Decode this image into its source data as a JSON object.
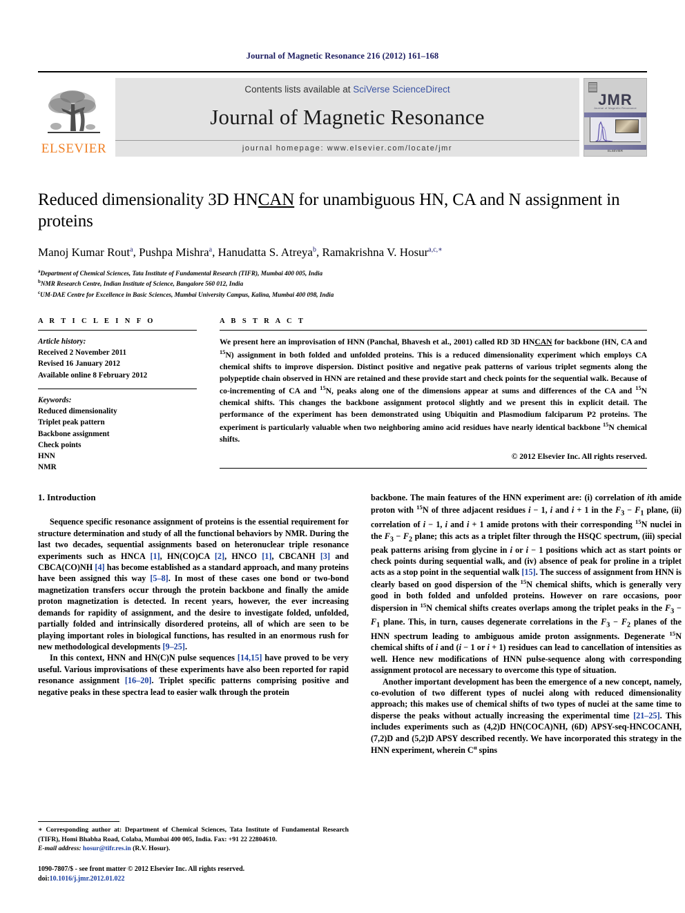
{
  "running_head": "Journal of Magnetic Resonance 216 (2012) 161–168",
  "masthead": {
    "publisher_logo_text": "ELSEVIER",
    "contents_prefix": "Contents lists available at ",
    "contents_link": "SciVerse ScienceDirect",
    "journal_name": "Journal of Magnetic Resonance",
    "homepage": "journal homepage: www.elsevier.com/locate/jmr",
    "cover": {
      "title": "JMR",
      "subtitle": "Journal of Magnetic Resonance",
      "publisher": "ELSEVIER"
    }
  },
  "article": {
    "title_part1": "Reduced dimensionality 3D HN",
    "title_underlined": "CAN",
    "title_part2": " for unambiguous HN, CA and N assignment in proteins",
    "authors": [
      {
        "name": "Manoj Kumar Rout",
        "sup": "a"
      },
      {
        "name": "Pushpa Mishra",
        "sup": "a"
      },
      {
        "name": "Hanudatta S. Atreya",
        "sup": "b"
      },
      {
        "name": "Ramakrishna V. Hosur",
        "sup": "a,c,∗"
      }
    ],
    "affiliations": [
      {
        "mark": "a",
        "text": "Department of Chemical Sciences, Tata Institute of Fundamental Research (TIFR), Mumbai 400 005, India"
      },
      {
        "mark": "b",
        "text": "NMR Research Centre, Indian Institute of Science, Bangalore 560 012, India"
      },
      {
        "mark": "c",
        "text": "UM-DAE Centre for Excellence in Basic Sciences, Mumbai University Campus, Kalina, Mumbai 400 098, India"
      }
    ]
  },
  "article_info": {
    "heading": "A R T I C L E   I N F O",
    "history_label": "Article history:",
    "history": [
      "Received 2 November 2011",
      "Revised 16 January 2012",
      "Available online 8 February 2012"
    ],
    "keywords_label": "Keywords:",
    "keywords": [
      "Reduced dimensionality",
      "Triplet peak pattern",
      "Backbone assignment",
      "Check points",
      "HNN",
      "NMR"
    ]
  },
  "abstract": {
    "heading": "A B S T R A C T",
    "text_1": "We present here an improvisation of HNN (Panchal, Bhavesh et al., 2001) called RD 3D HN",
    "text_underlined": "CAN",
    "text_2": " for backbone (HN, CA and ",
    "sup_1": "15",
    "text_3": "N) assignment in both folded and unfolded proteins. This is a reduced dimensionality experiment which employs CA chemical shifts to improve dispersion. Distinct positive and negative peak patterns of various triplet segments along the polypeptide chain observed in HNN are retained and these provide start and check points for the sequential walk. Because of co-incrementing of CA and ",
    "sup_2": "15",
    "text_4": "N, peaks along one of the dimensions appear at sums and differences of the CA and ",
    "sup_3": "15",
    "text_5": "N chemical shifts. This changes the backbone assignment protocol slightly and we present this in explicit detail. The performance of the experiment has been demonstrated using Ubiquitin and Plasmodium falciparum P2 proteins. The experiment is particularly valuable when two neighboring amino acid residues have nearly identical backbone ",
    "sup_4": "15",
    "text_6": "N chemical shifts.",
    "copyright": "© 2012 Elsevier Inc. All rights reserved."
  },
  "introduction": {
    "heading": "1. Introduction",
    "left_para_1": {
      "s1": "Sequence specific resonance assignment of proteins is the essential requirement for structure determination and study of all the functional behaviors by NMR. During the last two decades, sequential assignments based on heteronuclear triple resonance experiments such as HNCA ",
      "r1": "[1]",
      "s2": ", HN(CO)CA ",
      "r2": "[2]",
      "s3": ", HNCO ",
      "r3": "[1]",
      "s4": ", CBCANH ",
      "r4": "[3]",
      "s5": " and CBCA(CO)NH ",
      "r5": "[4]",
      "s6": " has become established as a standard approach, and many proteins have been assigned this way ",
      "r6": "[5–8]",
      "s7": ". In most of these cases one bond or two-bond magnetization transfers occur through the protein backbone and finally the amide proton magnetization is detected. In recent years, however, the ever increasing demands for rapidity of assignment, and the desire to investigate folded, unfolded, partially folded and intrinsically disordered proteins, all of which are seen to be playing important roles in biological functions, has resulted in an enormous rush for new methodological developments ",
      "r7": "[9–25]",
      "s8": "."
    },
    "left_para_2": {
      "s1": "In this context, HNN and HN(C)N pulse sequences ",
      "r1": "[14,15]",
      "s2": " have proved to be very useful. Various improvisations of these experiments have also been reported for rapid resonance assignment ",
      "r2": "[16–20]",
      "s3": ". Triplet specific patterns comprising positive and negative peaks in these spectra lead to easier walk through the protein"
    },
    "right_para_1": {
      "s1": "backbone. The main features of the HNN experiment are: (i) correlation of ",
      "i1": "i",
      "s2": "th amide proton with ",
      "sup1": "15",
      "s3": "N of three adjacent residues ",
      "i2": "i",
      "s4": " − 1, ",
      "i3": "i",
      "s5": " and ",
      "i4": "i",
      "s6": " + 1 in the ",
      "i5": "F",
      "sub1": "3",
      "s7": " − ",
      "i6": "F",
      "sub2": "1",
      "s8": " plane, (ii) correlation of ",
      "i7": "i",
      "s9": " − 1, ",
      "i8": "i",
      "s10": " and ",
      "i9": "i",
      "s11": " + 1 amide protons with their corresponding ",
      "sup2": "15",
      "s12": "N nuclei in the ",
      "i10": "F",
      "sub3": "3",
      "s13": " − ",
      "i11": "F",
      "sub4": "2",
      "s14": " plane; this acts as a triplet filter through the HSQC spectrum, (iii) special peak patterns arising from glycine in ",
      "i12": "i",
      "s15": " or ",
      "i13": "i",
      "s16": " − 1 positions which act as start points or check points during sequential walk, and (iv) absence of peak for proline in a triplet acts as a stop point in the sequential walk ",
      "r1": "[15]",
      "s17": ". The success of assignment from HNN is clearly based on good dispersion of the ",
      "sup3": "15",
      "s18": "N chemical shifts, which is generally very good in both folded and unfolded proteins. However on rare occasions, poor dispersion in ",
      "sup4": "15",
      "s19": "N chemical shifts creates overlaps among the triplet peaks in the ",
      "i14": "F",
      "sub5": "3",
      "s20": " − ",
      "i15": "F",
      "sub6": "1",
      "s21": " plane. This, in turn, causes degenerate correlations in the ",
      "i16": "F",
      "sub7": "3",
      "s22": " − ",
      "i17": "F",
      "sub8": "2",
      "s23": " planes of the HNN spectrum leading to ambiguous amide proton assignments. Degenerate ",
      "sup5": "15",
      "s24": "N chemical shifts of ",
      "i18": "i",
      "s25": " and (",
      "i19": "i",
      "s26": " − 1 or ",
      "i20": "i",
      "s27": " + 1) residues can lead to cancellation of intensities as well. Hence new modifications of HNN pulse-sequence along with corresponding assignment protocol are necessary to overcome this type of situation."
    },
    "right_para_2": {
      "s1": "Another important development has been the emergence of a new concept, namely, co-evolution of two different types of nuclei along with reduced dimensionality approach; this makes use of chemical shifts of two types of nuclei at the same time to disperse the peaks without actually increasing the experimental time ",
      "r1": "[21–25]",
      "s2": ". This includes experiments such as (4,2)D HN(COCA)NH, (6D) APSY-seq-HNCOCANH, (7,2)D and (5,2)D APSY described recently. We have incorporated this strategy in the HNN experiment, wherein C",
      "sup1": "α",
      "s3": " spins"
    }
  },
  "footnotes": {
    "corresponding": "∗ Corresponding author at: Department of Chemical Sciences, Tata Institute of Fundamental Research (TIFR), Homi Bhabha Road, Colaba, Mumbai 400 005, India. Fax: +91 22 22804610.",
    "email_label": "E-mail address:",
    "email": "hosur@tifr.res.in",
    "email_owner": "(R.V. Hosur).",
    "issn_line": "1090-7807/$ - see front matter © 2012 Elsevier Inc. All rights reserved.",
    "doi_label": "doi:",
    "doi": "10.1016/j.jmr.2012.01.022"
  },
  "colors": {
    "link": "#1a3fa0",
    "elsevier_orange": "#f08026",
    "runhead": "#1a1a5e"
  }
}
